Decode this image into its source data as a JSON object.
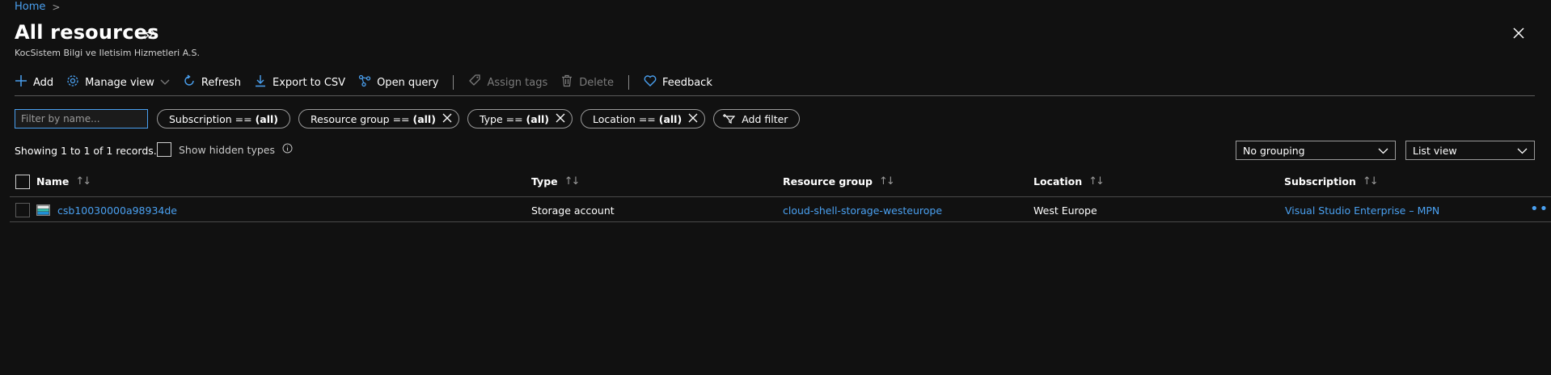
{
  "breadcrumb": {
    "home": "Home",
    "separator": ">"
  },
  "header": {
    "title": "All resources",
    "subtitle": "KocSistem Bilgi ve Iletisim Hizmetleri A.S."
  },
  "toolbar": {
    "add": "Add",
    "manage_view": "Manage view",
    "refresh": "Refresh",
    "export_csv": "Export to CSV",
    "open_query": "Open query",
    "assign_tags": "Assign tags",
    "delete": "Delete",
    "feedback": "Feedback"
  },
  "filters": {
    "name_placeholder": "Filter by name...",
    "subscription": {
      "label": "Subscription == ",
      "value": "(all)"
    },
    "resource_group": {
      "label": "Resource group == ",
      "value": "(all)"
    },
    "type": {
      "label": "Type == ",
      "value": "(all)"
    },
    "location": {
      "label": "Location == ",
      "value": "(all)"
    },
    "add_filter": "Add filter"
  },
  "summary": {
    "records": "Showing 1 to 1 of 1 records.",
    "show_hidden": "Show hidden types"
  },
  "view": {
    "grouping": "No grouping",
    "list_view": "List view"
  },
  "table": {
    "columns": {
      "name": "Name",
      "type": "Type",
      "resource_group": "Resource group",
      "location": "Location",
      "subscription": "Subscription"
    },
    "rows": [
      {
        "name": "csb10030000a98934de",
        "type": "Storage account",
        "resource_group": "cloud-shell-storage-westeurope",
        "location": "West Europe",
        "subscription": "Visual Studio Enterprise – MPN"
      }
    ]
  },
  "colors": {
    "accent": "#4aa0f0",
    "background": "#111111"
  },
  "icons": [
    "pin-icon",
    "close-icon",
    "plus-icon",
    "gear-icon",
    "chevron-down-icon",
    "refresh-icon",
    "download-icon",
    "query-icon",
    "tag-icon",
    "trash-icon",
    "heart-icon",
    "filter-icon",
    "info-icon",
    "storage-account-icon",
    "more-icon"
  ]
}
